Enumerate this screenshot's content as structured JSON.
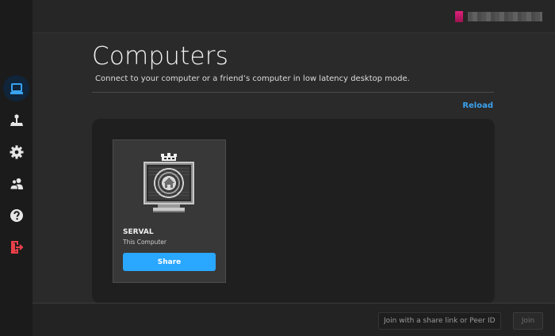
{
  "account": {
    "avatar_color": "#e0207a",
    "name": ""
  },
  "sidebar": {
    "items": [
      {
        "id": "computers",
        "icon": "computer-icon",
        "active": true
      },
      {
        "id": "arcade",
        "icon": "joystick-icon",
        "active": false
      },
      {
        "id": "settings",
        "icon": "gear-icon",
        "active": false
      },
      {
        "id": "friends",
        "icon": "users-icon",
        "active": false
      },
      {
        "id": "help",
        "icon": "help-icon",
        "active": false
      },
      {
        "id": "logout",
        "icon": "logout-icon",
        "active": false
      }
    ],
    "active_color": "#3aa3ef",
    "logout_color": "#e8404a"
  },
  "page": {
    "title": "Computers",
    "subtitle": "Connect to your computer or a friend’s computer in low latency desktop mode.",
    "reload_label": "Reload"
  },
  "computers": [
    {
      "name": "SERVAL",
      "subtitle": "This Computer",
      "action_label": "Share",
      "badge_icon": "crown-icon",
      "image_icon": "pixel-monitor-home-icon"
    }
  ],
  "footer": {
    "join_placeholder": "Join with a share link or Peer ID.",
    "join_value": "",
    "join_label": "Join"
  },
  "colors": {
    "accent": "#2aa7ff",
    "background": "#2a2a2a",
    "panel": "#1f1f1f",
    "sidebar": "#1b1b1b"
  }
}
